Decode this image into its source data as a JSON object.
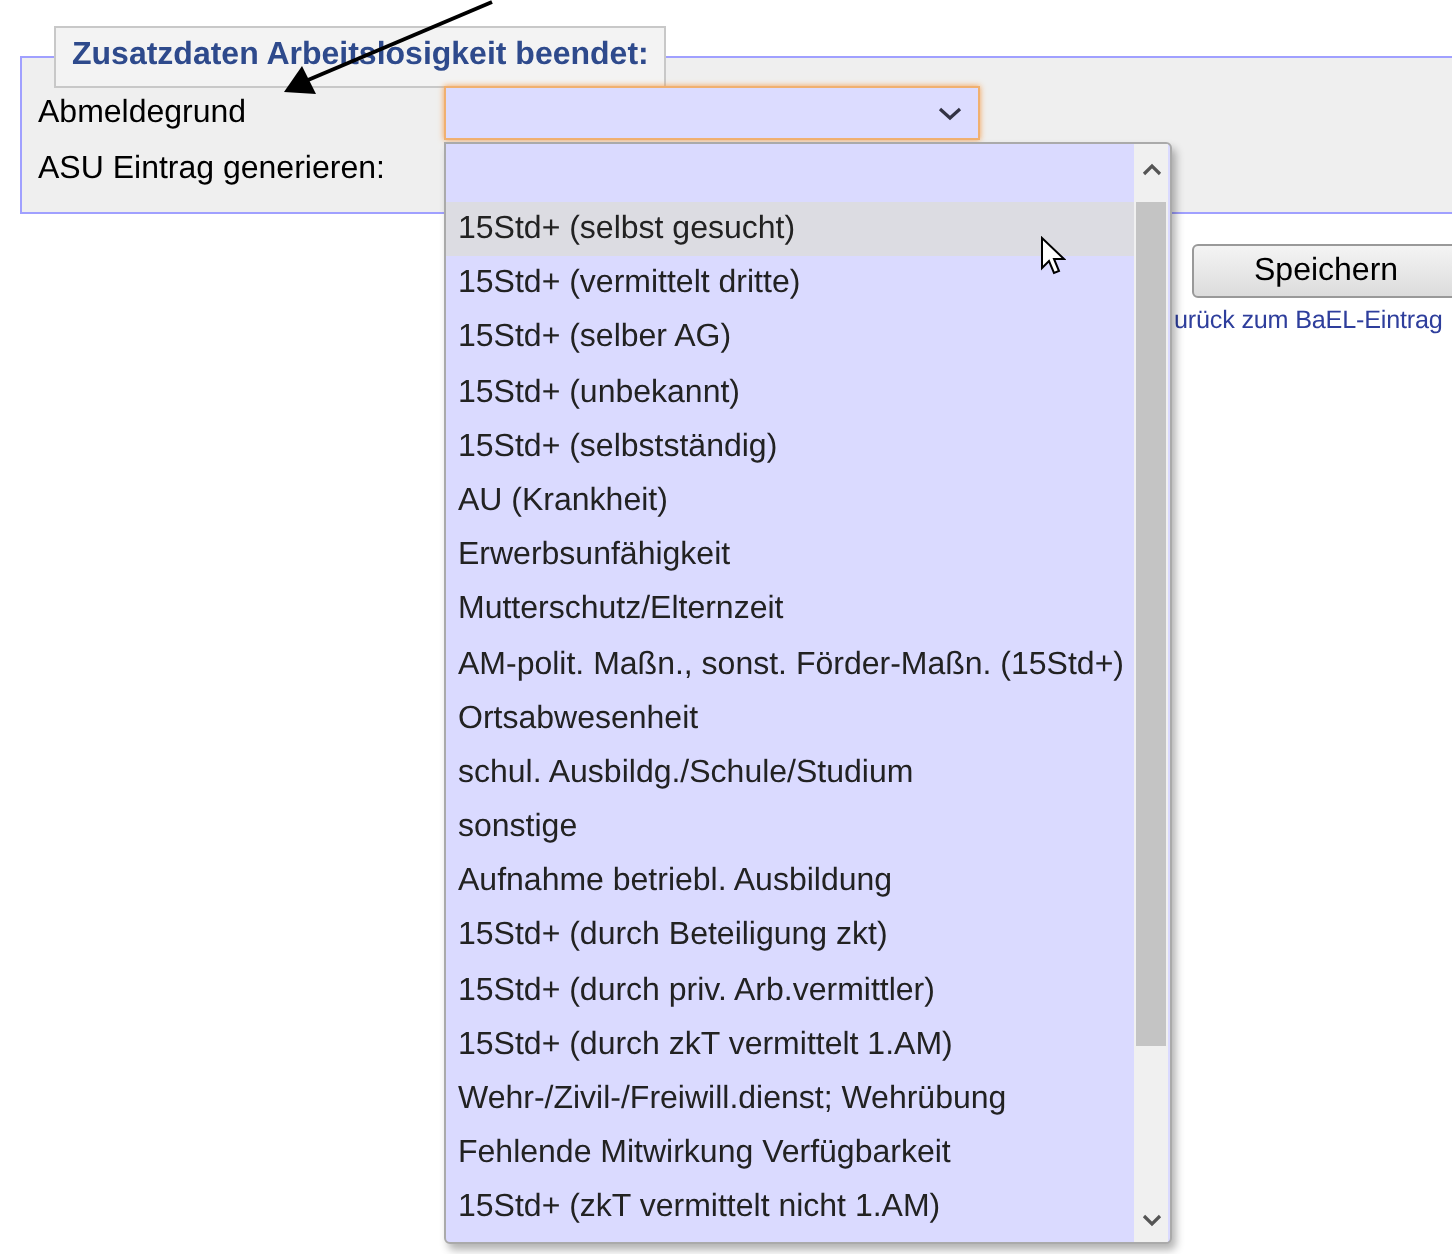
{
  "fieldset": {
    "legend": "Zusatzdaten Arbeitslosigkeit beendet:",
    "fields": [
      {
        "label": "Abmeldegrund",
        "kind": "select"
      },
      {
        "label": "ASU Eintrag generieren:",
        "kind": "none"
      }
    ]
  },
  "dropdown": {
    "options": [
      {
        "kind": "blank",
        "selected": false
      },
      {
        "kind": "option",
        "label": "15Std+ (selbst gesucht)",
        "selected": true
      },
      {
        "kind": "option",
        "label": "15Std+ (vermittelt dritte)",
        "selected": false
      },
      {
        "kind": "option",
        "label": "15Std+ (selber AG)",
        "selected": false
      },
      {
        "kind": "option",
        "label": "15Std+ (unbekannt)",
        "selected": false
      },
      {
        "kind": "option",
        "label": "15Std+ (selbstständig)",
        "selected": false
      },
      {
        "kind": "option",
        "label": "AU (Krankheit)",
        "selected": false
      },
      {
        "kind": "option",
        "label": "Erwerbsunfähigkeit",
        "selected": false
      },
      {
        "kind": "option",
        "label": "Mutterschutz/Elternzeit",
        "selected": false
      },
      {
        "kind": "option",
        "label": "AM-polit. Maßn., sonst. Förder-Maßn. (15Std+)",
        "selected": false
      },
      {
        "kind": "option",
        "label": "Ortsabwesenheit",
        "selected": false
      },
      {
        "kind": "option",
        "label": "schul. Ausbildg./Schule/Studium",
        "selected": false
      },
      {
        "kind": "option",
        "label": "sonstige",
        "selected": false
      },
      {
        "kind": "option",
        "label": "Aufnahme betriebl. Ausbildung",
        "selected": false
      },
      {
        "kind": "option",
        "label": "15Std+ (durch Beteiligung zkt)",
        "selected": false
      },
      {
        "kind": "option",
        "label": "15Std+ (durch priv. Arb.vermittler)",
        "selected": false
      },
      {
        "kind": "option",
        "label": "15Std+ (durch zkT vermittelt 1.AM)",
        "selected": false
      },
      {
        "kind": "option",
        "label": "Wehr-/Zivil-/Freiwill.dienst; Wehrübung",
        "selected": false
      },
      {
        "kind": "option",
        "label": "Fehlende Mitwirkung Verfügbarkeit",
        "selected": false
      },
      {
        "kind": "option",
        "label": "15Std+ (zkT vermittelt nicht 1.AM)",
        "selected": false
      }
    ]
  },
  "save_button": "Speichern",
  "back_link": "urück zum BaEL-Eintrag"
}
